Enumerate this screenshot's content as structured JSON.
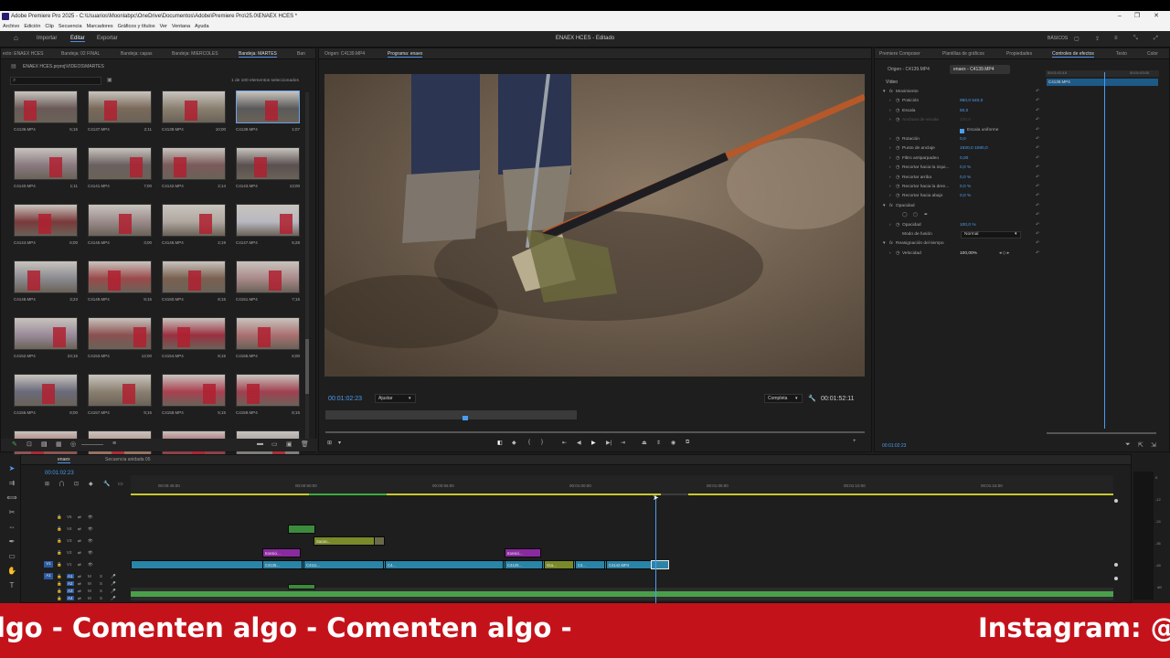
{
  "window": {
    "title": "Adobe Premiere Pro 2025 - C:\\Usuarios\\Moonlabpc\\OneDrive\\Documentos\\Adobe\\Premiere Pro\\25.0\\ENAEX HCES *",
    "controls": [
      "–",
      "❐",
      "✕"
    ]
  },
  "menu": [
    "Archivo",
    "Edición",
    "Clip",
    "Secuencia",
    "Marcadores",
    "Gráficos y títulos",
    "Ver",
    "Ventana",
    "Ayuda"
  ],
  "workspace": {
    "home_icon": "home-icon",
    "tabs": [
      "Importar",
      "Editar",
      "Exportar"
    ],
    "active_tab": "Editar",
    "center_title": "ENAEX HCES - Editado",
    "right_label": "BÁSICOS"
  },
  "project_panel": {
    "tabs": [
      "ecto: ENAEX HCES",
      "Bandeja: 02 FINAL",
      "Bandeja: capas",
      "Bandeja: MIERCOLES",
      "Bandeja: MARTES",
      "Ban"
    ],
    "active_tab": "Bandeja: MARTES",
    "path": "ENAEX HCES.prproj\\VIDEOS\\MARTES",
    "selection_info": "1 de 100 elementos seleccionados",
    "thumbs": [
      {
        "name": "C4136.MP4",
        "dur": "5;15"
      },
      {
        "name": "C4137.MP4",
        "dur": "2;11"
      },
      {
        "name": "C4138.MP4",
        "dur": "10;00"
      },
      {
        "name": "C4139.MP4",
        "dur": "1;07"
      },
      {
        "name": "C4140.MP4",
        "dur": "1;11"
      },
      {
        "name": "C4141.MP4",
        "dur": "7;00"
      },
      {
        "name": "C4142.MP4",
        "dur": "2;14"
      },
      {
        "name": "C4143.MP4",
        "dur": "13;00"
      },
      {
        "name": "C4144.MP4",
        "dur": "6;00"
      },
      {
        "name": "C4145.MP4",
        "dur": "3;00"
      },
      {
        "name": "C4146.MP4",
        "dur": "2;19"
      },
      {
        "name": "C4147.MP4",
        "dur": "5;28"
      },
      {
        "name": "C4148.MP4",
        "dur": "3;23"
      },
      {
        "name": "C4149.MP4",
        "dur": "9;15"
      },
      {
        "name": "C4150.MP4",
        "dur": "8;15"
      },
      {
        "name": "C4151.MP4",
        "dur": "7;15"
      },
      {
        "name": "C4152.MP4",
        "dur": "23;15"
      },
      {
        "name": "C4153.MP4",
        "dur": "12;00"
      },
      {
        "name": "C4154.MP4",
        "dur": "8;15"
      },
      {
        "name": "C4155.MP4",
        "dur": "6;00"
      },
      {
        "name": "C4156.MP4",
        "dur": "8;00"
      },
      {
        "name": "C4157.MP4",
        "dur": "9;15"
      },
      {
        "name": "C4158.MP4",
        "dur": "5;15"
      },
      {
        "name": "C4159.MP4",
        "dur": "8;15"
      },
      {
        "name": "",
        "dur": ""
      },
      {
        "name": "",
        "dur": ""
      },
      {
        "name": "",
        "dur": ""
      },
      {
        "name": "",
        "dur": ""
      }
    ]
  },
  "monitor": {
    "tabs": [
      "Origen: C4139.MP4",
      "Programa: enaex"
    ],
    "active_tab": "Programa: enaex",
    "timecode": "00:01:02:23",
    "fit": "Ajustar",
    "quality": "Completa",
    "duration": "00:01:52:11"
  },
  "effects_panel": {
    "tabs": [
      "Premiere Composer",
      "Plantillas de gráficos",
      "Propiedades",
      "Controles de efectos",
      "Texto",
      "Color"
    ],
    "active_tab": "Controles de efectos",
    "subtabs": [
      "Origen - C4139.MP4",
      "enaex - C4139.MP4"
    ],
    "clip_label": "C4139.MP4",
    "ruler_a": "00:01:02:15",
    "ruler_b": "00:01:03:00",
    "section_video": "Vídeo",
    "rows": [
      {
        "label": "Movimiento",
        "value": "",
        "indent": 1,
        "fx": true
      },
      {
        "label": "Posición",
        "value": "960,0    540,0",
        "indent": 2
      },
      {
        "label": "Escala",
        "value": "50,0",
        "indent": 2
      },
      {
        "label": "Anchura de escala",
        "value": "100,0",
        "indent": 2,
        "dim": true
      },
      {
        "label": "Escala uniforme",
        "value": "",
        "indent": 3,
        "check": true
      },
      {
        "label": "Rotación",
        "value": "0,0",
        "indent": 2
      },
      {
        "label": "Punto de anclaje",
        "value": "1920,0    1080,0",
        "indent": 2
      },
      {
        "label": "Filtro antiparpadeo",
        "value": "0,00",
        "indent": 2
      },
      {
        "label": "Recortar hacia la izqui...",
        "value": "0,0 %",
        "indent": 2
      },
      {
        "label": "Recortar arriba",
        "value": "0,0 %",
        "indent": 2
      },
      {
        "label": "Recortar hacia la dere...",
        "value": "0,0 %",
        "indent": 2
      },
      {
        "label": "Recortar hacia abajo",
        "value": "0,0 %",
        "indent": 2
      },
      {
        "label": "Opacidad",
        "value": "",
        "indent": 1,
        "fx": true
      },
      {
        "label": "",
        "value": "",
        "indent": 2,
        "shapes": true
      },
      {
        "label": "Opacidad",
        "value": "100,0 %",
        "indent": 2
      },
      {
        "label": "Modo de fusión",
        "value": "Normal",
        "indent": 2,
        "select": true
      },
      {
        "label": "Reasignación del tiempo",
        "value": "",
        "indent": 1,
        "fx": true
      },
      {
        "label": "Velocidad",
        "value": "100,00%",
        "indent": 2,
        "white": true
      }
    ],
    "footer_tc": "00:01:02:23"
  },
  "timeline": {
    "tabs": [
      "enaex",
      "Secuencia anidada 05"
    ],
    "timecode": "00:01:02:23",
    "ruler": [
      "00:00:45:00",
      "00:00:50:00",
      "00:00:55:00",
      "00:01:00:00",
      "00:01:05:00",
      "00:01:10:00",
      "00:01:15:00"
    ],
    "tracks": [
      {
        "name": "V5",
        "row": 0
      },
      {
        "name": "V4",
        "row": 1
      },
      {
        "name": "V3",
        "row": 2
      },
      {
        "name": "V2",
        "row": 3
      },
      {
        "name": "V1",
        "row": 4
      },
      {
        "name": "A1",
        "row": 5
      },
      {
        "name": "A2",
        "row": 6
      },
      {
        "name": "A3",
        "row": 7
      },
      {
        "name": "A4",
        "row": 8
      }
    ],
    "clips_v3": [
      {
        "label": "Sacan...",
        "color": "#7a8a2a"
      }
    ],
    "clips_v2": [
      {
        "label": "transici...",
        "color": "#8a2aa0"
      },
      {
        "label": "transici...",
        "color": "#8a2aa0"
      }
    ],
    "clips_v1": [
      {
        "label": "C4135...",
        "color": "#2a84a8"
      },
      {
        "label": "C4111...",
        "color": "#2a84a8"
      },
      {
        "label": "C4...",
        "color": "#2a84a8"
      },
      {
        "label": "C4120...",
        "color": "#2a84a8"
      },
      {
        "label": "Sca...",
        "color": "#7a8a2a"
      },
      {
        "label": "C4...",
        "color": "#2a84a8"
      },
      {
        "label": "C4142.MP4",
        "color": "#2a84a8"
      }
    ],
    "vu_scale": [
      "0",
      "-12",
      "-24",
      "-36",
      "-48",
      "dB"
    ]
  },
  "banner": {
    "scroll_text": "lgo  - Comenten algo - Comenten algo -",
    "right_text": "Instagram: @t"
  }
}
